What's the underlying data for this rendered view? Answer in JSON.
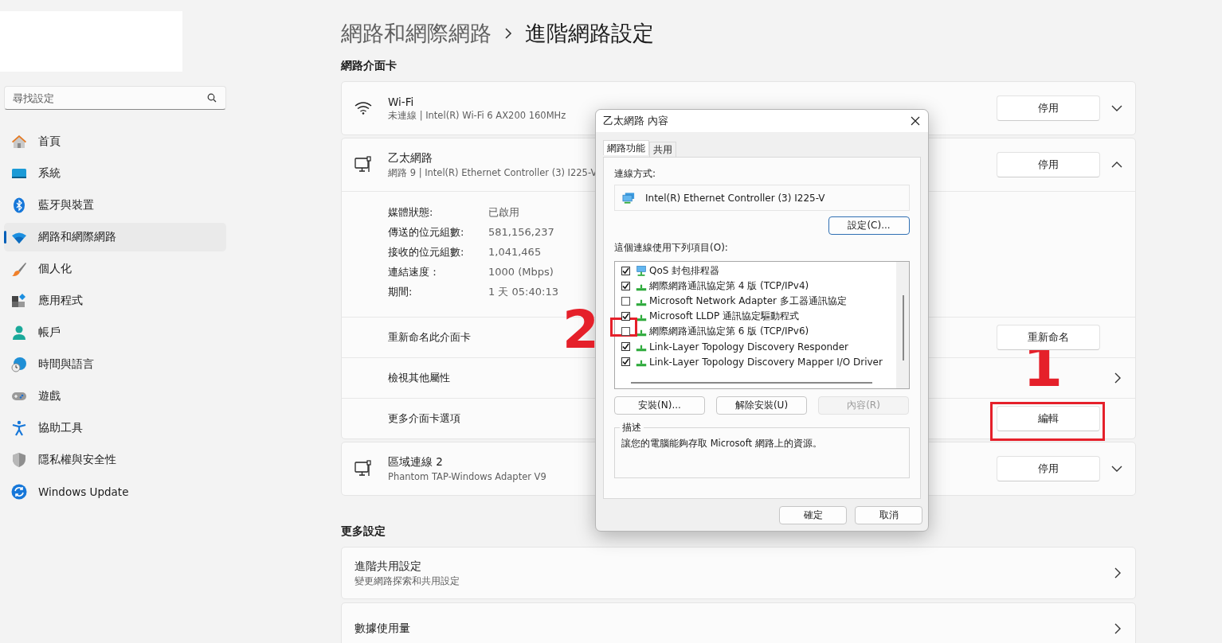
{
  "search": {
    "placeholder": "尋找設定"
  },
  "sidebar": {
    "items": [
      {
        "label": "首頁",
        "selected": false
      },
      {
        "label": "系統",
        "selected": false
      },
      {
        "label": "藍牙與裝置",
        "selected": false
      },
      {
        "label": "網路和網際網路",
        "selected": true
      },
      {
        "label": "個人化",
        "selected": false
      },
      {
        "label": "應用程式",
        "selected": false
      },
      {
        "label": "帳戶",
        "selected": false
      },
      {
        "label": "時間與語言",
        "selected": false
      },
      {
        "label": "遊戲",
        "selected": false
      },
      {
        "label": "協助工具",
        "selected": false
      },
      {
        "label": "隱私權與安全性",
        "selected": false
      },
      {
        "label": "Windows Update",
        "selected": false
      }
    ]
  },
  "breadcrumb": {
    "parent": "網路和網際網路",
    "current": "進階網路設定"
  },
  "adapters_section": {
    "heading": "網路介面卡",
    "adapters": [
      {
        "kind": "wifi",
        "name": "Wi-Fi",
        "detail": "未連線 | Intel(R) Wi-Fi 6 AX200 160MHz",
        "button": "停用",
        "expanded": false
      },
      {
        "kind": "wired",
        "name": "乙太網路",
        "detail": "網路 9 | Intel(R) Ethernet Controller (3) I225-V",
        "button": "停用",
        "expanded": true,
        "properties": [
          {
            "label": "媒體狀態:",
            "value": "已啟用"
          },
          {
            "label": "傳送的位元組數:",
            "value": "581,156,237"
          },
          {
            "label": "接收的位元組數:",
            "value": "1,041,465"
          },
          {
            "label": "連結速度：",
            "value": "1000 (Mbps)"
          },
          {
            "label": "期間:",
            "value": "1 天 05:40:13"
          }
        ],
        "actions": [
          {
            "kind": "button",
            "label": "重新命名此介面卡",
            "button": "重新命名"
          },
          {
            "kind": "link",
            "label": "檢視其他屬性"
          },
          {
            "kind": "button",
            "label": "更多介面卡選項",
            "button": "編輯"
          }
        ]
      },
      {
        "kind": "wired",
        "name": "區域連線 2",
        "detail": "Phantom TAP-Windows Adapter V9",
        "button": "停用",
        "expanded": false
      }
    ]
  },
  "more_settings": {
    "heading": "更多設定",
    "items": [
      {
        "title": "進階共用設定",
        "subtitle": "變更網路探索和共用設定"
      },
      {
        "title": "數據使用量"
      }
    ]
  },
  "dialog": {
    "title": "乙太網路 內容",
    "tabs": [
      {
        "label": "網路功能",
        "selected": true
      },
      {
        "label": "共用",
        "selected": false
      }
    ],
    "connect_label": "連線方式:",
    "adapter": "Intel(R) Ethernet Controller (3) I225-V",
    "configure_button": "設定(C)...",
    "items_label": "這個連線使用下列項目(O):",
    "items": [
      {
        "kind": "service",
        "label": "QoS 封包排程器",
        "checked": true
      },
      {
        "kind": "protocol",
        "label": "網際網路通訊協定第 4 版 (TCP/IPv4)",
        "checked": true
      },
      {
        "kind": "protocol",
        "label": "Microsoft Network Adapter 多工器通訊協定",
        "checked": false
      },
      {
        "kind": "protocol",
        "label": "Microsoft LLDP 通訊協定驅動程式",
        "checked": true
      },
      {
        "kind": "protocol",
        "label": "網際網路通訊協定第 6 版 (TCP/IPv6)",
        "checked": false
      },
      {
        "kind": "protocol",
        "label": "Link-Layer Topology Discovery Responder",
        "checked": true
      },
      {
        "kind": "protocol",
        "label": "Link-Layer Topology Discovery Mapper I/O Driver",
        "checked": true
      }
    ],
    "buttons": [
      {
        "label": "安裝(N)...",
        "disabled": false
      },
      {
        "label": "解除安裝(U)",
        "disabled": false
      },
      {
        "label": "內容(R)",
        "disabled": true
      }
    ],
    "description": {
      "legend": "描述",
      "text": "讓您的電腦能夠存取 Microsoft 網路上的資源。"
    },
    "footer_buttons": [
      "確定",
      "取消"
    ]
  },
  "annotations": [
    {
      "label": "1"
    },
    {
      "label": "2"
    }
  ]
}
